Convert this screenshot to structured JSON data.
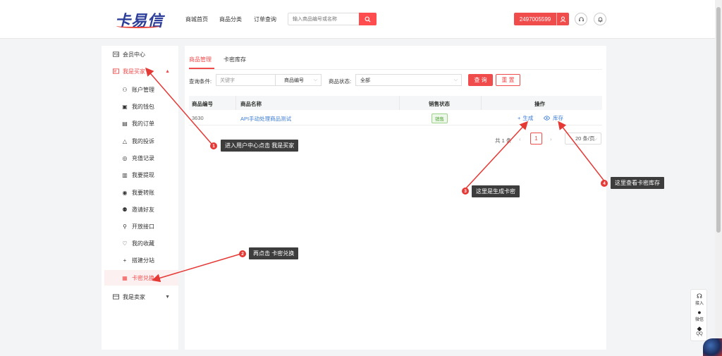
{
  "header": {
    "logo_text": "卡易信",
    "nav": [
      "商城首页",
      "商品分类",
      "订单查询"
    ],
    "search_placeholder": "输入商品编号或名称",
    "user_id": "2497005599"
  },
  "sidebar": {
    "member_center": "会员中心",
    "buyer_group": "我是买家",
    "buyer_items": [
      "账户管理",
      "我的钱包",
      "我的订单",
      "我的投诉",
      "充值记录",
      "我要提现",
      "我要转账",
      "邀请好友",
      "开放接口",
      "我的收藏",
      "搭建分站",
      "卡密兑换"
    ],
    "seller_group": "我是卖家"
  },
  "main": {
    "tabs": [
      "商品管理",
      "卡密库存"
    ],
    "filter": {
      "label": "查询条件:",
      "keyword_placeholder": "关键字",
      "field_select": "商品编号",
      "status_label": "商品状态:",
      "status_select": "全部",
      "query_btn": "查 询",
      "reset_btn": "重 置"
    },
    "table": {
      "headers": [
        "商品编号",
        "商品名称",
        "销售状态",
        "操作"
      ],
      "rows": [
        {
          "id": "3630",
          "name": "API手动处理商品测试",
          "status": "销售",
          "op_generate": "生成",
          "op_stock": "库存"
        }
      ]
    },
    "pager": {
      "total": "共 1 条",
      "page": "1",
      "page_size": "20 条/页"
    }
  },
  "annotations": {
    "n1": "1",
    "t1": "进入用户中心点击  我是买家",
    "n2": "2",
    "t2": "再点击  卡密兑换",
    "n3": "3",
    "t3": "这里是生成卡密",
    "n4": "4",
    "t4": "这里查看卡密库存"
  },
  "float_bar": [
    "接入",
    "微信",
    "QQ"
  ],
  "colors": {
    "accent": "#f14c4c",
    "link": "#3a7bd5",
    "note_bg": "#3d3d3d",
    "arrow": "#e53935"
  }
}
